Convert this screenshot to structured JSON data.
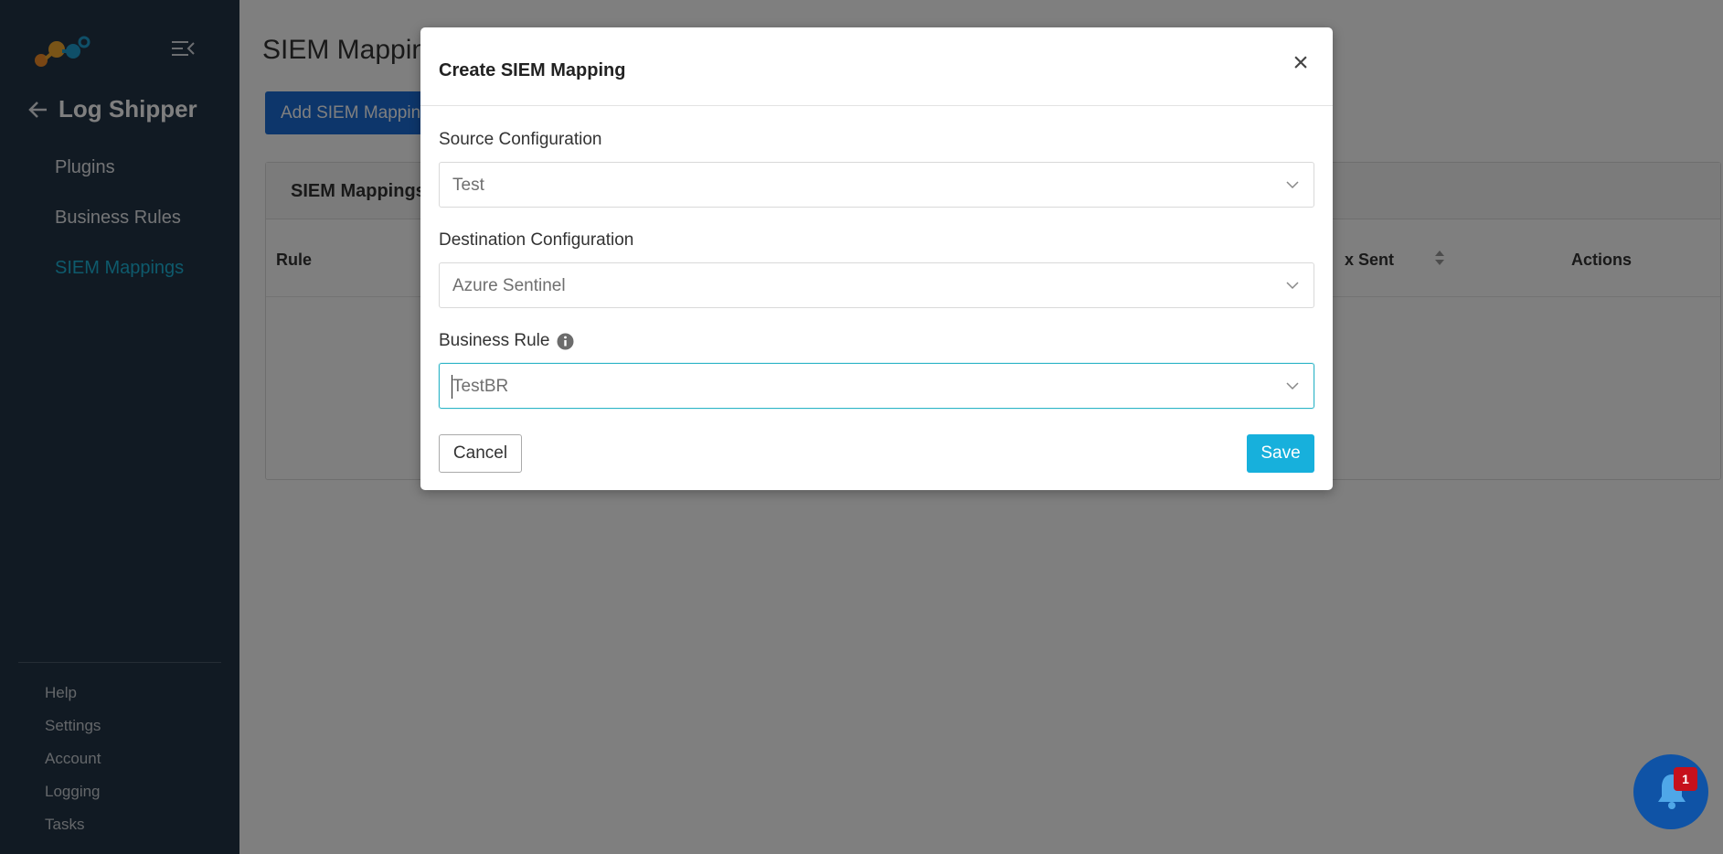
{
  "sidebar": {
    "title": "Log Shipper",
    "nav": [
      {
        "label": "Plugins"
      },
      {
        "label": "Business Rules"
      },
      {
        "label": "SIEM Mappings"
      }
    ],
    "bottom": [
      {
        "label": "Help"
      },
      {
        "label": "Settings"
      },
      {
        "label": "Account"
      },
      {
        "label": "Logging"
      },
      {
        "label": "Tasks"
      }
    ]
  },
  "main": {
    "page_title": "SIEM Mapping",
    "add_button": "Add SIEM Mapping",
    "card_title": "SIEM Mappings",
    "columns": {
      "rule": "Rule",
      "sent": "x Sent",
      "actions": "Actions"
    }
  },
  "modal": {
    "title": "Create SIEM Mapping",
    "close": "×",
    "fields": {
      "source": {
        "label": "Source Configuration",
        "value": "Test"
      },
      "destination": {
        "label": "Destination Configuration",
        "value": "Azure Sentinel"
      },
      "business_rule": {
        "label": "Business Rule",
        "value": "TestBR"
      }
    },
    "cancel_label": "Cancel",
    "save_label": "Save"
  },
  "notifications": {
    "count": "1"
  },
  "colors": {
    "sidebar_bg": "#233446",
    "accent": "#1cb5d9",
    "primary_button": "#1b6dd7",
    "save_button": "#17b0dc",
    "badge": "#c6111c"
  }
}
